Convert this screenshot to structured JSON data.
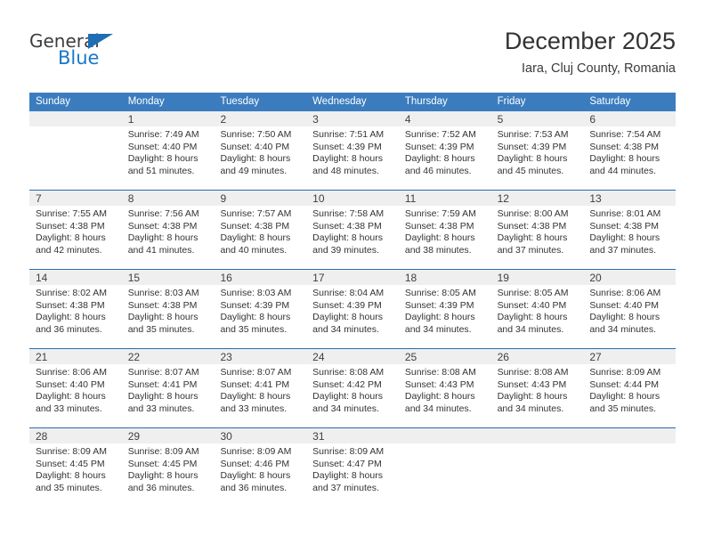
{
  "brand": {
    "name_part1": "General",
    "name_part2": "Blue",
    "triangle_color": "#1f6db5",
    "blue_color": "#1878c8"
  },
  "header": {
    "title": "December 2025",
    "subtitle": "Iara, Cluj County, Romania"
  },
  "theme": {
    "header_bg": "#3b7cbf",
    "header_text": "#ffffff",
    "row_divider": "#2b6cab",
    "daynum_band": "#efefef",
    "cell_bg": "#ffffff",
    "body_text": "#333333"
  },
  "weekday_headers": [
    "Sunday",
    "Monday",
    "Tuesday",
    "Wednesday",
    "Thursday",
    "Friday",
    "Saturday"
  ],
  "weeks": [
    [
      {
        "day": "",
        "lines": []
      },
      {
        "day": "1",
        "lines": [
          "Sunrise: 7:49 AM",
          "Sunset: 4:40 PM",
          "Daylight: 8 hours",
          "and 51 minutes."
        ]
      },
      {
        "day": "2",
        "lines": [
          "Sunrise: 7:50 AM",
          "Sunset: 4:40 PM",
          "Daylight: 8 hours",
          "and 49 minutes."
        ]
      },
      {
        "day": "3",
        "lines": [
          "Sunrise: 7:51 AM",
          "Sunset: 4:39 PM",
          "Daylight: 8 hours",
          "and 48 minutes."
        ]
      },
      {
        "day": "4",
        "lines": [
          "Sunrise: 7:52 AM",
          "Sunset: 4:39 PM",
          "Daylight: 8 hours",
          "and 46 minutes."
        ]
      },
      {
        "day": "5",
        "lines": [
          "Sunrise: 7:53 AM",
          "Sunset: 4:39 PM",
          "Daylight: 8 hours",
          "and 45 minutes."
        ]
      },
      {
        "day": "6",
        "lines": [
          "Sunrise: 7:54 AM",
          "Sunset: 4:38 PM",
          "Daylight: 8 hours",
          "and 44 minutes."
        ]
      }
    ],
    [
      {
        "day": "7",
        "lines": [
          "Sunrise: 7:55 AM",
          "Sunset: 4:38 PM",
          "Daylight: 8 hours",
          "and 42 minutes."
        ]
      },
      {
        "day": "8",
        "lines": [
          "Sunrise: 7:56 AM",
          "Sunset: 4:38 PM",
          "Daylight: 8 hours",
          "and 41 minutes."
        ]
      },
      {
        "day": "9",
        "lines": [
          "Sunrise: 7:57 AM",
          "Sunset: 4:38 PM",
          "Daylight: 8 hours",
          "and 40 minutes."
        ]
      },
      {
        "day": "10",
        "lines": [
          "Sunrise: 7:58 AM",
          "Sunset: 4:38 PM",
          "Daylight: 8 hours",
          "and 39 minutes."
        ]
      },
      {
        "day": "11",
        "lines": [
          "Sunrise: 7:59 AM",
          "Sunset: 4:38 PM",
          "Daylight: 8 hours",
          "and 38 minutes."
        ]
      },
      {
        "day": "12",
        "lines": [
          "Sunrise: 8:00 AM",
          "Sunset: 4:38 PM",
          "Daylight: 8 hours",
          "and 37 minutes."
        ]
      },
      {
        "day": "13",
        "lines": [
          "Sunrise: 8:01 AM",
          "Sunset: 4:38 PM",
          "Daylight: 8 hours",
          "and 37 minutes."
        ]
      }
    ],
    [
      {
        "day": "14",
        "lines": [
          "Sunrise: 8:02 AM",
          "Sunset: 4:38 PM",
          "Daylight: 8 hours",
          "and 36 minutes."
        ]
      },
      {
        "day": "15",
        "lines": [
          "Sunrise: 8:03 AM",
          "Sunset: 4:38 PM",
          "Daylight: 8 hours",
          "and 35 minutes."
        ]
      },
      {
        "day": "16",
        "lines": [
          "Sunrise: 8:03 AM",
          "Sunset: 4:39 PM",
          "Daylight: 8 hours",
          "and 35 minutes."
        ]
      },
      {
        "day": "17",
        "lines": [
          "Sunrise: 8:04 AM",
          "Sunset: 4:39 PM",
          "Daylight: 8 hours",
          "and 34 minutes."
        ]
      },
      {
        "day": "18",
        "lines": [
          "Sunrise: 8:05 AM",
          "Sunset: 4:39 PM",
          "Daylight: 8 hours",
          "and 34 minutes."
        ]
      },
      {
        "day": "19",
        "lines": [
          "Sunrise: 8:05 AM",
          "Sunset: 4:40 PM",
          "Daylight: 8 hours",
          "and 34 minutes."
        ]
      },
      {
        "day": "20",
        "lines": [
          "Sunrise: 8:06 AM",
          "Sunset: 4:40 PM",
          "Daylight: 8 hours",
          "and 34 minutes."
        ]
      }
    ],
    [
      {
        "day": "21",
        "lines": [
          "Sunrise: 8:06 AM",
          "Sunset: 4:40 PM",
          "Daylight: 8 hours",
          "and 33 minutes."
        ]
      },
      {
        "day": "22",
        "lines": [
          "Sunrise: 8:07 AM",
          "Sunset: 4:41 PM",
          "Daylight: 8 hours",
          "and 33 minutes."
        ]
      },
      {
        "day": "23",
        "lines": [
          "Sunrise: 8:07 AM",
          "Sunset: 4:41 PM",
          "Daylight: 8 hours",
          "and 33 minutes."
        ]
      },
      {
        "day": "24",
        "lines": [
          "Sunrise: 8:08 AM",
          "Sunset: 4:42 PM",
          "Daylight: 8 hours",
          "and 34 minutes."
        ]
      },
      {
        "day": "25",
        "lines": [
          "Sunrise: 8:08 AM",
          "Sunset: 4:43 PM",
          "Daylight: 8 hours",
          "and 34 minutes."
        ]
      },
      {
        "day": "26",
        "lines": [
          "Sunrise: 8:08 AM",
          "Sunset: 4:43 PM",
          "Daylight: 8 hours",
          "and 34 minutes."
        ]
      },
      {
        "day": "27",
        "lines": [
          "Sunrise: 8:09 AM",
          "Sunset: 4:44 PM",
          "Daylight: 8 hours",
          "and 35 minutes."
        ]
      }
    ],
    [
      {
        "day": "28",
        "lines": [
          "Sunrise: 8:09 AM",
          "Sunset: 4:45 PM",
          "Daylight: 8 hours",
          "and 35 minutes."
        ]
      },
      {
        "day": "29",
        "lines": [
          "Sunrise: 8:09 AM",
          "Sunset: 4:45 PM",
          "Daylight: 8 hours",
          "and 36 minutes."
        ]
      },
      {
        "day": "30",
        "lines": [
          "Sunrise: 8:09 AM",
          "Sunset: 4:46 PM",
          "Daylight: 8 hours",
          "and 36 minutes."
        ]
      },
      {
        "day": "31",
        "lines": [
          "Sunrise: 8:09 AM",
          "Sunset: 4:47 PM",
          "Daylight: 8 hours",
          "and 37 minutes."
        ]
      },
      {
        "day": "",
        "lines": []
      },
      {
        "day": "",
        "lines": []
      },
      {
        "day": "",
        "lines": []
      }
    ]
  ]
}
